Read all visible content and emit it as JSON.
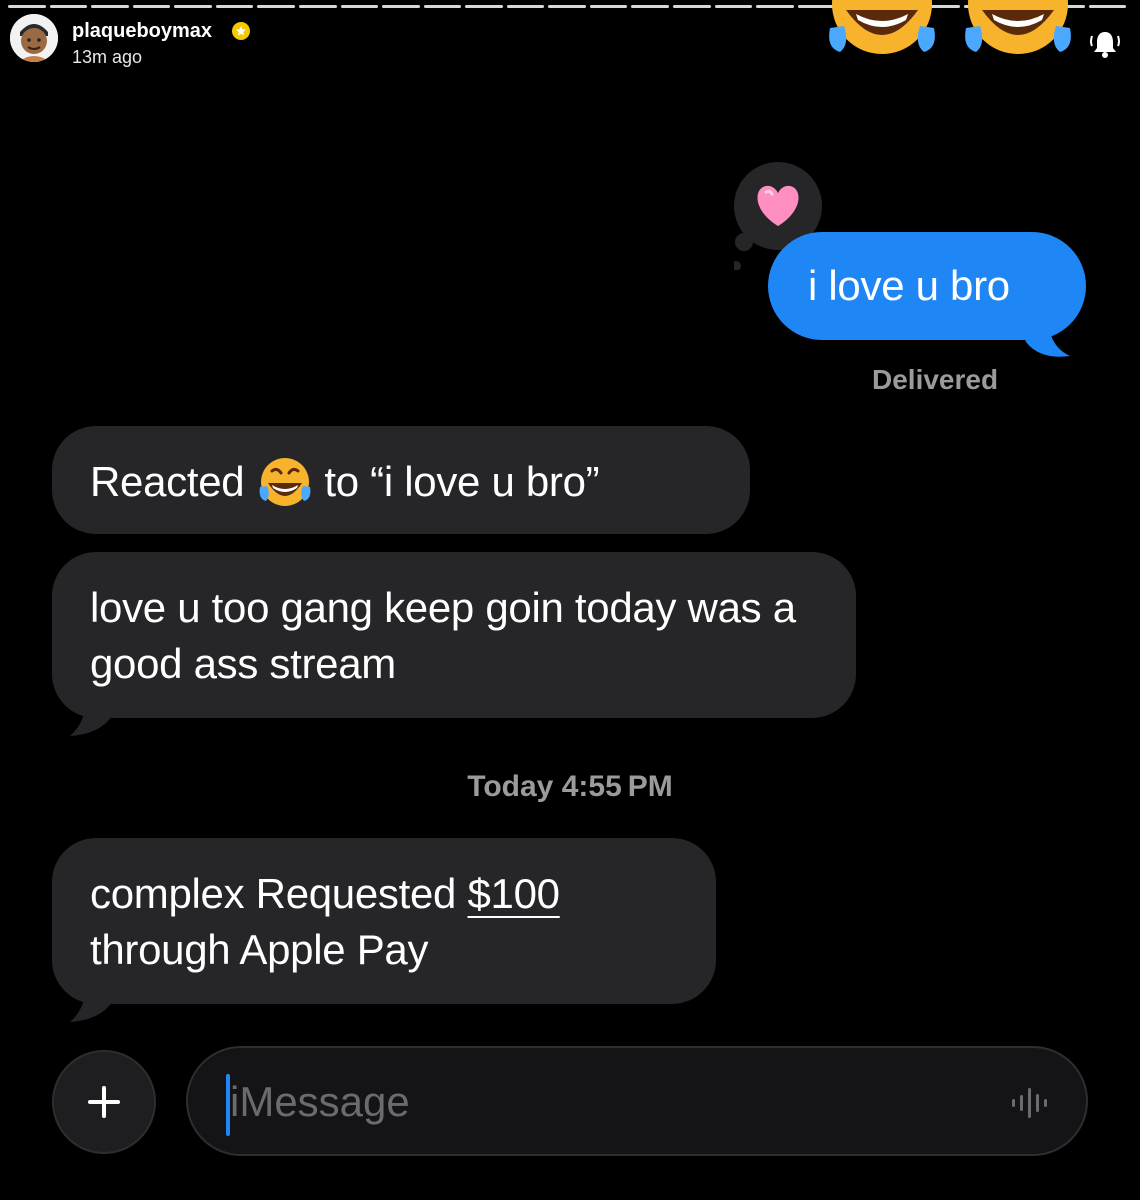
{
  "story": {
    "segments": [
      1,
      1,
      1,
      1,
      1,
      1,
      1,
      1,
      1,
      1,
      1,
      1,
      1,
      1,
      1,
      1,
      1,
      1,
      1,
      1,
      1,
      1,
      1,
      1,
      1,
      1,
      1
    ],
    "username": "plaqueboymax",
    "time_ago": "13m ago",
    "verified_badge": "star-badge-icon",
    "notification_icon": "bell-icon"
  },
  "conversation": {
    "outgoing": {
      "text": "i love u bro",
      "status": "Delivered",
      "reaction": "heart-icon"
    },
    "incoming": [
      {
        "prefix": "Reacted",
        "emoji": "laughing-crying-emoji",
        "suffix": "to “i love u bro”"
      },
      {
        "text": "love u too gang keep goin today was a good ass stream"
      }
    ],
    "timestamp": {
      "day": "Today",
      "time": "4:55 PM"
    },
    "payment": {
      "before": "complex Requested ",
      "amount": "$100",
      "after": " through Apple Pay"
    }
  },
  "input_bar": {
    "plus_label": "+",
    "placeholder": "iMessage",
    "audio_icon": "waveform-icon"
  },
  "colors": {
    "background": "#000000",
    "outgoing_bubble": "#1f87f5",
    "incoming_bubble": "#262629",
    "muted_text": "#9b9b9b"
  }
}
